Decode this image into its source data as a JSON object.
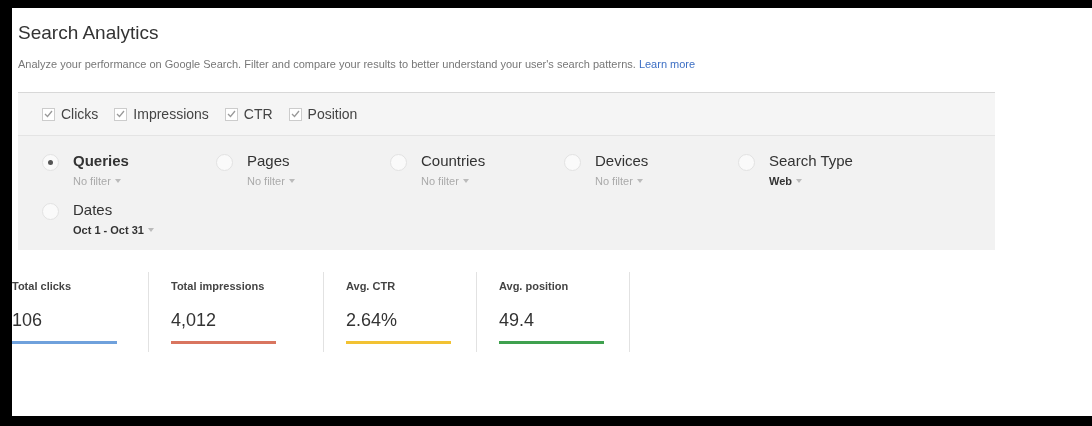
{
  "title": "Search Analytics",
  "description": "Analyze your performance on Google Search. Filter and compare your results to better understand your user's search patterns.",
  "learn_more": "Learn more",
  "metric_toggles": [
    {
      "label": "Clicks",
      "checked": true
    },
    {
      "label": "Impressions",
      "checked": true
    },
    {
      "label": "CTR",
      "checked": true
    },
    {
      "label": "Position",
      "checked": true
    }
  ],
  "groupings": [
    {
      "label": "Queries",
      "selected": true,
      "filter": "No filter",
      "filter_set": false
    },
    {
      "label": "Pages",
      "selected": false,
      "filter": "No filter",
      "filter_set": false
    },
    {
      "label": "Countries",
      "selected": false,
      "filter": "No filter",
      "filter_set": false
    },
    {
      "label": "Devices",
      "selected": false,
      "filter": "No filter",
      "filter_set": false
    },
    {
      "label": "Search Type",
      "selected": false,
      "filter": "Web",
      "filter_set": true
    },
    {
      "label": "Dates",
      "selected": false,
      "filter": "Oct 1 - Oct 31",
      "filter_set": true
    }
  ],
  "totals": [
    {
      "label": "Total clicks",
      "value": "106",
      "color": "#6fa1dc"
    },
    {
      "label": "Total impressions",
      "value": "4,012",
      "color": "#d9755f"
    },
    {
      "label": "Avg. CTR",
      "value": "2.64%",
      "color": "#f2c233"
    },
    {
      "label": "Avg. position",
      "value": "49.4",
      "color": "#3fa14f"
    }
  ]
}
